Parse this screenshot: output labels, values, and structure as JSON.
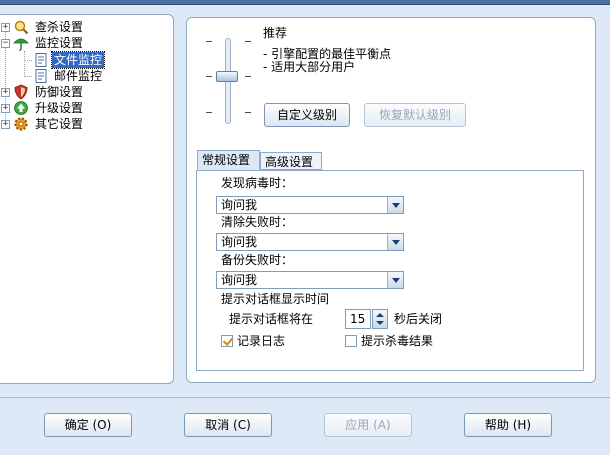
{
  "tree": {
    "items": [
      {
        "label": "查杀设置"
      },
      {
        "label": "监控设置"
      },
      {
        "label": "文件监控"
      },
      {
        "label": "邮件监控"
      },
      {
        "label": "防御设置"
      },
      {
        "label": "升级设置"
      },
      {
        "label": "其它设置"
      }
    ],
    "selected_index": 2
  },
  "level": {
    "title": "推荐",
    "desc_1": "- 引擎配置的最佳平衡点",
    "desc_2": "- 适用大部分用户",
    "custom_button": "自定义级别",
    "restore_button": "恢复默认级别"
  },
  "tabs": [
    "常规设置",
    "高级设置"
  ],
  "general": {
    "virus_found_label": "发现病毒时：",
    "virus_found_value": "询问我",
    "clean_fail_label": "清除失败时：",
    "clean_fail_value": "询问我",
    "backup_fail_label": "备份失败时：",
    "backup_fail_value": "询问我",
    "dialog_time_label": "提示对话框显示时间",
    "dialog_prefix": "提示对话框将在",
    "dialog_seconds": "15",
    "dialog_suffix": "秒后关闭",
    "log_label": "记录日志",
    "log_checked": true,
    "result_label": "提示杀毒结果",
    "result_checked": false
  },
  "footer": {
    "ok": "确定 (O)",
    "cancel": "取消 (C)",
    "apply": "应用 (A)",
    "help": "帮助 (H)"
  }
}
